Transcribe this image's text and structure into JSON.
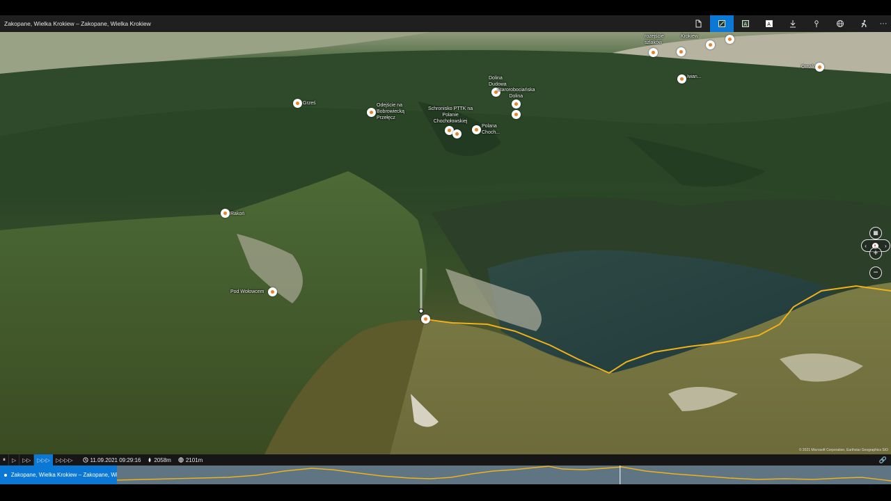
{
  "window": {
    "title": "Zakopane, Wielka Krokiew – Zakopane, Wielka Krokiew"
  },
  "toolbar": {
    "more_label": "···",
    "buttons": [
      "file-icon",
      "map-view-icon",
      "photo-view-icon",
      "label-icon",
      "download-icon",
      "pin-icon",
      "globe-icon",
      "hiker-icon",
      "more-icon"
    ],
    "active": "map-view-icon",
    "accent": "#0a78d4"
  },
  "map": {
    "pois": [
      {
        "label": "rozejście\nszlaków"
      },
      {
        "label": "Krokiew"
      },
      {
        "label": "Ornak"
      },
      {
        "label": "Grześ"
      },
      {
        "label": "Odejście na\nBobrowiecką\nPrzełęcz"
      },
      {
        "label": "Dolina\nDudowa"
      },
      {
        "label": "Starorobociańska\nDolina"
      },
      {
        "label": "Schronisko PTTK na\nPolanie\nChochołowskiej"
      },
      {
        "label": "Polana\nChoch..."
      },
      {
        "label": "Rakoń"
      },
      {
        "label": "Pod Wołowcem"
      },
      {
        "label": "Iwan..."
      }
    ],
    "track_color": "#f0b21a",
    "zoom_in_label": "+",
    "zoom_out_label": "−",
    "compass_left": "‹",
    "compass_right": "›",
    "copyright": "© 2021 Microsoft Corporation, Earthstar Geographics SIO"
  },
  "playback": {
    "buttons": [
      "⏸",
      "▷",
      "▷▷",
      "▷▷▷",
      "▷▷▷▷"
    ],
    "active_index": 3
  },
  "status": {
    "datetime": "11.09.2021 09:29:16",
    "altitude": "2058m",
    "elevation": "2101m"
  },
  "track": {
    "name": "Zakopane, Wielka Krokiew – Zakopane, Wielk",
    "profile_color": "#f0b21a",
    "cursor_fraction": 0.65
  }
}
